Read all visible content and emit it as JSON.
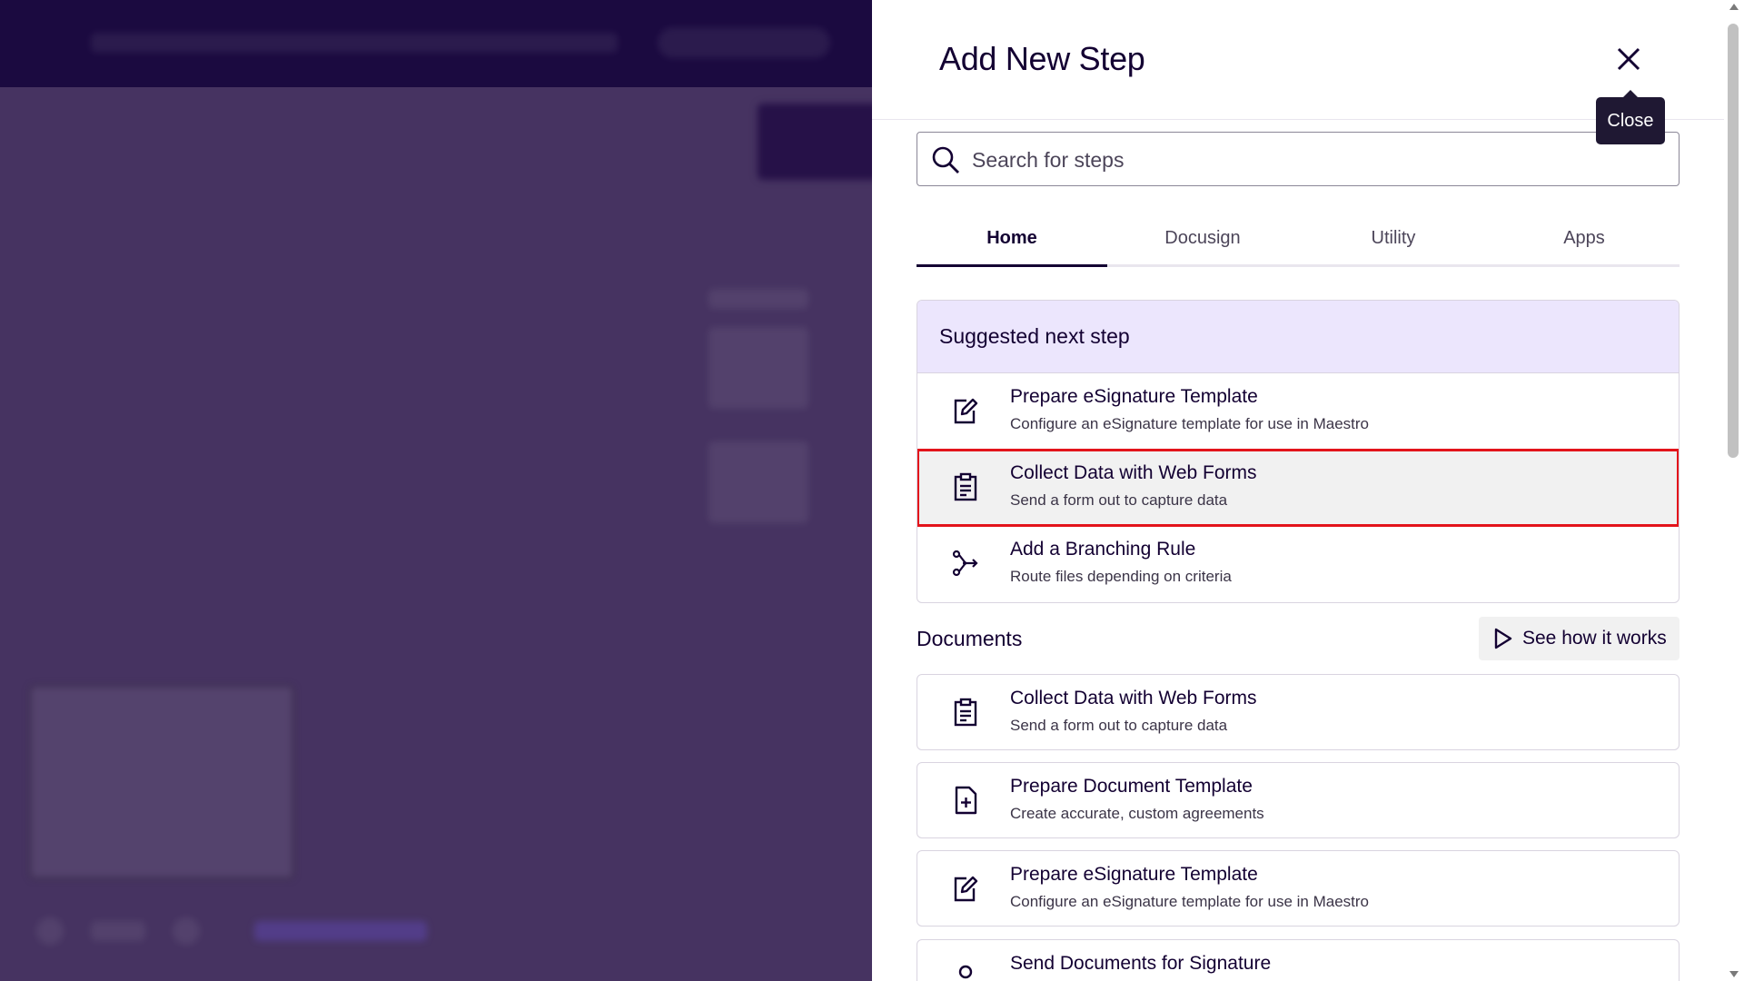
{
  "panel": {
    "title": "Add New Step",
    "close_tooltip": "Close"
  },
  "search": {
    "placeholder": "Search for steps"
  },
  "tabs": [
    {
      "label": "Home",
      "active": true
    },
    {
      "label": "Docusign",
      "active": false
    },
    {
      "label": "Utility",
      "active": false
    },
    {
      "label": "Apps",
      "active": false
    }
  ],
  "suggested": {
    "heading": "Suggested next step",
    "items": [
      {
        "title": "Prepare eSignature Template",
        "subtitle": "Configure an eSignature template for use in Maestro",
        "icon": "edit-document-icon"
      },
      {
        "title": "Collect Data with Web Forms",
        "subtitle": "Send a form out to capture data",
        "icon": "clipboard-icon",
        "selected": true
      },
      {
        "title": "Add a Branching Rule",
        "subtitle": "Route files depending on criteria",
        "icon": "branch-icon"
      }
    ]
  },
  "documents": {
    "heading": "Documents",
    "see_how_label": "See how it works",
    "items": [
      {
        "title": "Collect Data with Web Forms",
        "subtitle": "Send a form out to capture data",
        "icon": "clipboard-icon"
      },
      {
        "title": "Prepare Document Template",
        "subtitle": "Create accurate, custom agreements",
        "icon": "document-add-icon"
      },
      {
        "title": "Prepare eSignature Template",
        "subtitle": "Configure an eSignature template for use in Maestro",
        "icon": "edit-document-icon"
      },
      {
        "title": "Send Documents for Signature",
        "subtitle": "",
        "icon": "signer-icon"
      }
    ]
  },
  "colors": {
    "backdrop": "#463361",
    "suggested_header": "#ece6fd",
    "selection_outline": "#e3141b",
    "text_primary": "#130032"
  }
}
